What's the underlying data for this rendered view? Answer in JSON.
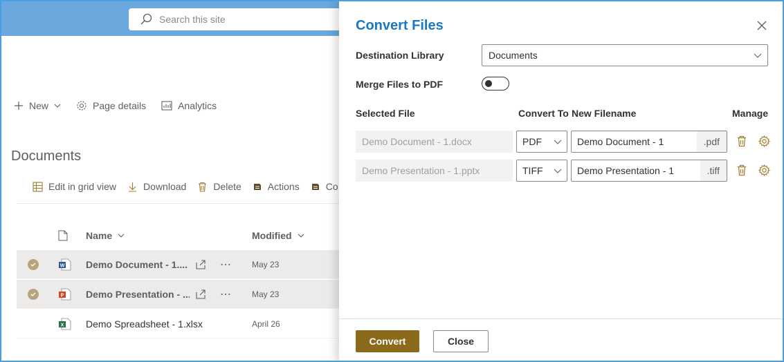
{
  "header": {
    "search_placeholder": "Search this site"
  },
  "command_bar": {
    "new_label": "New",
    "page_details_label": "Page details",
    "analytics_label": "Analytics"
  },
  "library": {
    "title": "Documents",
    "commands": {
      "edit_grid": "Edit in grid view",
      "download": "Download",
      "delete": "Delete",
      "actions": "Actions",
      "truncated": "Co"
    },
    "columns": {
      "name": "Name",
      "modified": "Modified"
    },
    "rows": [
      {
        "name": "Demo Document - 1....",
        "modified": "May 23",
        "selected": true,
        "icon": "word-file-icon"
      },
      {
        "name": "Demo Presentation - ...",
        "modified": "May 23",
        "selected": true,
        "icon": "powerpoint-file-icon"
      },
      {
        "name": "Demo Spreadsheet - 1.xlsx",
        "modified": "April 26",
        "selected": false,
        "icon": "excel-file-icon"
      }
    ]
  },
  "panel": {
    "title": "Convert Files",
    "destination_label": "Destination Library",
    "destination_value": "Documents",
    "merge_label": "Merge Files to PDF",
    "merge_on": false,
    "headers": {
      "selected_file": "Selected File",
      "convert_to": "Convert To",
      "new_filename": "New Filename",
      "manage": "Manage"
    },
    "files": [
      {
        "selected_file": "Demo Document - 1.docx",
        "convert_to": "PDF",
        "new_filename": "Demo Document - 1",
        "extension": ".pdf"
      },
      {
        "selected_file": "Demo Presentation - 1.pptx",
        "convert_to": "TIFF",
        "new_filename": "Demo Presentation - 1",
        "extension": ".tiff"
      }
    ],
    "convert_button": "Convert",
    "close_button": "Close"
  },
  "colors": {
    "accent_blue": "#1a78c2",
    "primary_button": "#8c6a1c",
    "action_icon": "#a07c2a",
    "header_band": "#6aa8dd"
  }
}
